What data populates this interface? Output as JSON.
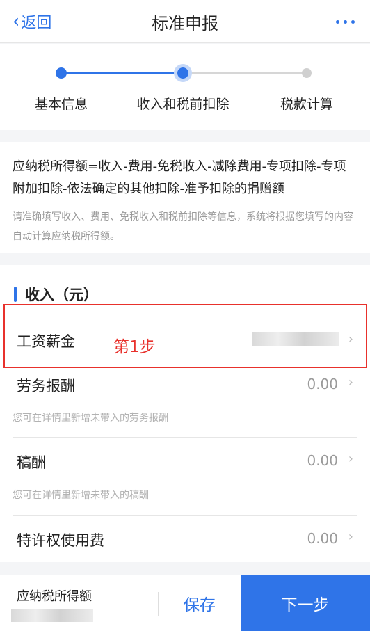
{
  "nav": {
    "back_label": "返回",
    "title": "标准申报"
  },
  "steps": [
    {
      "label": "基本信息",
      "state": "done"
    },
    {
      "label": "收入和税前扣除",
      "state": "current"
    },
    {
      "label": "税款计算",
      "state": "pending"
    }
  ],
  "formula": {
    "main": "应纳税所得额=收入-费用-免税收入-减除费用-专项扣除-专项附加扣除-依法确定的其他扣除-准予扣除的捐赠额",
    "hint": "请准确填写收入、费用、免税收入和税前扣除等信息，系统将根据您填写的内容自动计算应纳税所得额。"
  },
  "income": {
    "header": "收入（元）",
    "items": [
      {
        "name": "工资薪金",
        "value": ""
      },
      {
        "name": "劳务报酬",
        "value": "0.00",
        "sub": "您可在详情里新增未带入的劳务报酬"
      },
      {
        "name": "稿酬",
        "value": "0.00",
        "sub": "您可在详情里新增未带入的稿酬"
      },
      {
        "name": "特许权使用费",
        "value": "0.00"
      }
    ]
  },
  "annotation": "第1步",
  "footer": {
    "label": "应纳税所得额",
    "save": "保存",
    "next": "下一步"
  },
  "colors": {
    "accent": "#2f74e8",
    "annotation": "#e8312c"
  }
}
